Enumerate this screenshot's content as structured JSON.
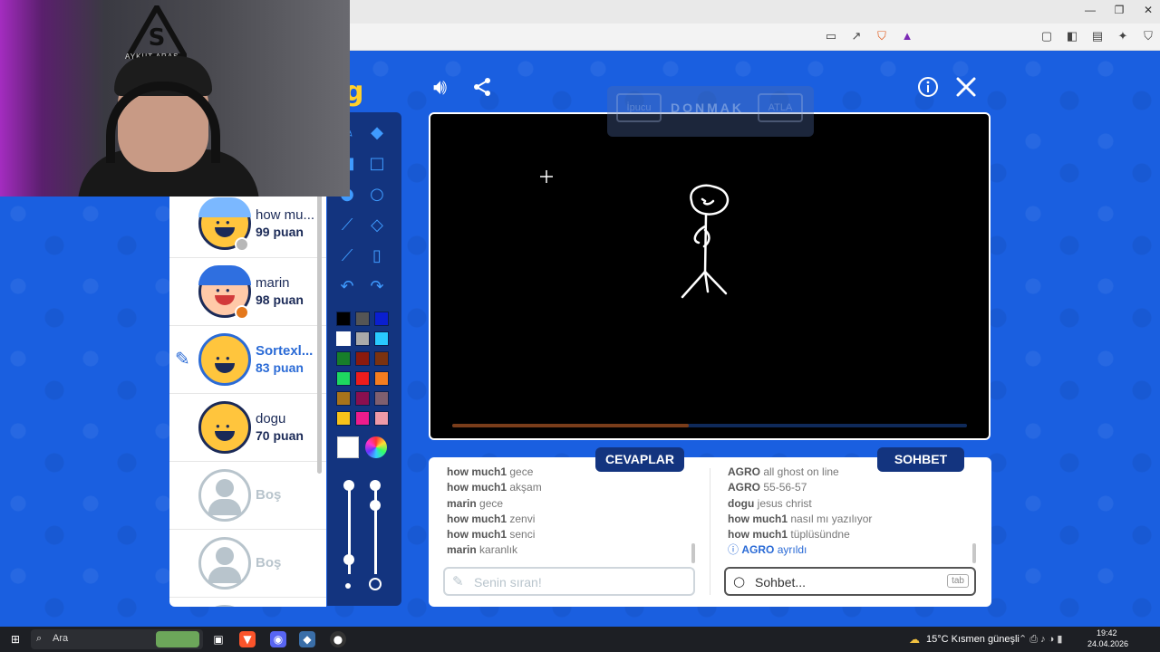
{
  "browser": {
    "window_controls": [
      "—",
      "❐",
      "✕"
    ]
  },
  "webcam": {
    "logo_text": "AYKUT ARAS"
  },
  "game": {
    "logo_fragment": "g",
    "sound_icon": "speaker-icon",
    "share_icon": "share-icon",
    "info_icon": "info-icon",
    "close_icon": "close-icon",
    "round_overlay": {
      "title": "DONMAK",
      "left_btn": "İpucu",
      "right_btn": "ATLA"
    },
    "progress_fraction": 0.46
  },
  "players": [
    {
      "name": "how mu...",
      "score": "99 puan",
      "status_color": "#b7b7b7"
    },
    {
      "name": "marin",
      "score": "98 puan",
      "status_color": "#e4781c"
    },
    {
      "name": "Sortexl...",
      "score": "83 puan",
      "drawing": true
    },
    {
      "name": "dogu",
      "score": "70 puan"
    },
    {
      "name": "Boş"
    },
    {
      "name": "Boş"
    }
  ],
  "tools": {
    "colors": [
      [
        "#000000",
        "#555555",
        "#0a1fd0"
      ],
      [
        "#ffffff",
        "#aaaaaa",
        "#29c9ff"
      ],
      [
        "#177e2a",
        "#8b1a0d",
        "#7a3210"
      ],
      [
        "#1ed760",
        "#ee1c1c",
        "#f57d1f"
      ],
      [
        "#a8731b",
        "#8a0f4f",
        "#7f5f6f"
      ],
      [
        "#f8c21b",
        "#ee1c8c",
        "#ee9aa8"
      ]
    ]
  },
  "answers": {
    "tab_label": "CEVAPLAR",
    "messages": [
      {
        "user": "how much1",
        "text": "gece"
      },
      {
        "user": "how much1",
        "text": "akşam"
      },
      {
        "user": "marin",
        "text": "gece"
      },
      {
        "user": "how much1",
        "text": "zenvi"
      },
      {
        "user": "how much1",
        "text": "senci"
      },
      {
        "user": "marin",
        "text": "karanlık"
      }
    ],
    "placeholder": "Senin sıran!"
  },
  "chat": {
    "tab_label": "SOHBET",
    "messages": [
      {
        "user": "AGRO",
        "text": "all ghost on line"
      },
      {
        "user": "AGRO",
        "text": "55-56-57"
      },
      {
        "user": "dogu",
        "text": "jesus christ"
      },
      {
        "user": "how much1",
        "text": "nasıl mı yazılıyor"
      },
      {
        "user": "how much1",
        "text": "tüplüsündne"
      }
    ],
    "system": {
      "user": "AGRO",
      "text": "ayrıldı"
    },
    "placeholder": "Sohbet...",
    "key_hint": "tab"
  },
  "taskbar": {
    "search_label": "Ara",
    "weather": "15°C  Kısmen güneşli",
    "time": "19:42",
    "date": "24.04.2026"
  }
}
